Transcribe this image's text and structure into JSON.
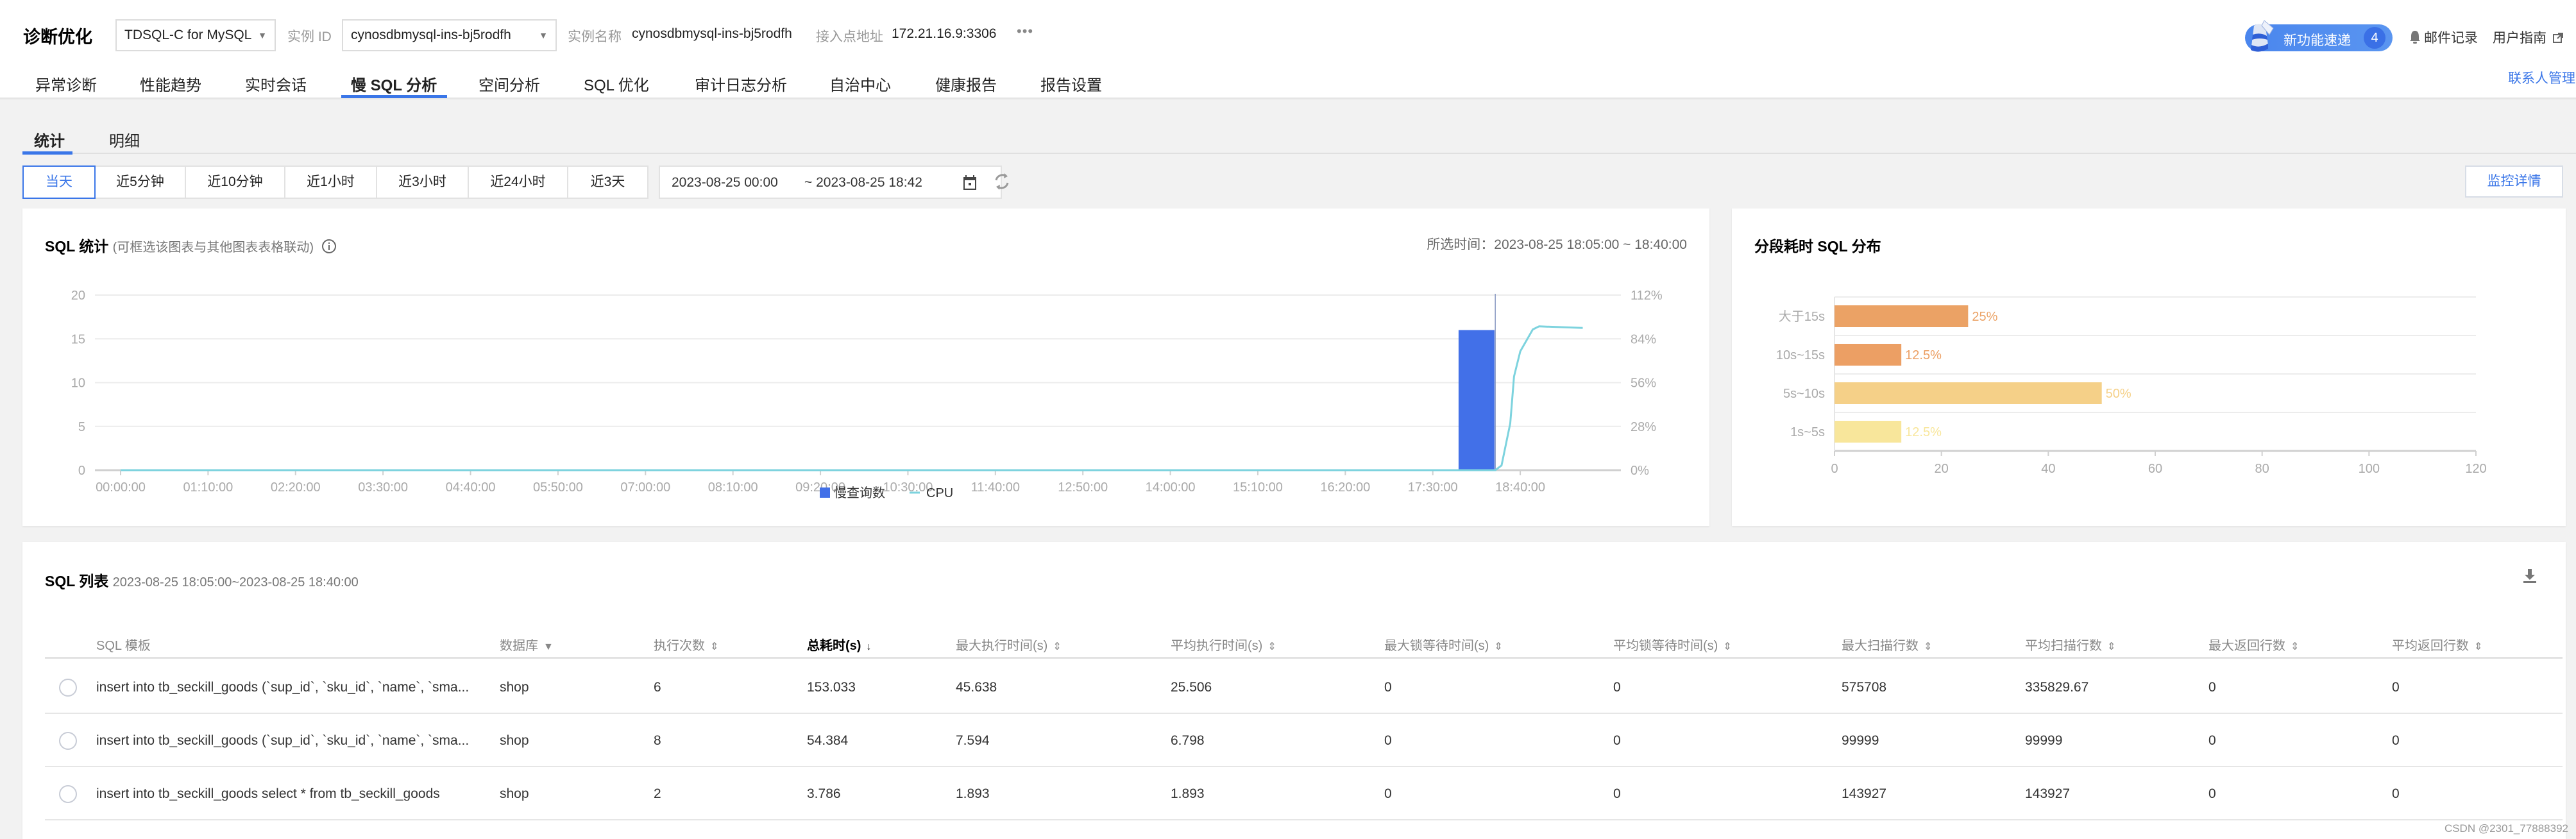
{
  "header": {
    "app_title": "诊断优化",
    "db_type": "TDSQL-C for MySQL",
    "instance_id_label": "实例 ID",
    "instance_id": "cynosdbmysql-ins-bj5rodfh",
    "instance_name_label": "实例名称",
    "instance_name": "cynosdbmysql-ins-bj5rodfh",
    "endpoint_label": "接入点地址",
    "endpoint": "172.21.16.9:3306",
    "more": "•••",
    "news_label": "新功能速递",
    "news_count": "4",
    "mail_label": "邮件记录",
    "guide_label": "用户指南",
    "contact_label": "联系人管理"
  },
  "nav_tabs": [
    {
      "label": "异常诊断"
    },
    {
      "label": "性能趋势"
    },
    {
      "label": "实时会话"
    },
    {
      "label": "慢 SQL 分析",
      "active": true
    },
    {
      "label": "空间分析"
    },
    {
      "label": "SQL 优化"
    },
    {
      "label": "审计日志分析"
    },
    {
      "label": "自治中心"
    },
    {
      "label": "健康报告"
    },
    {
      "label": "报告设置"
    }
  ],
  "sub_tabs": [
    {
      "label": "统计",
      "active": true
    },
    {
      "label": "明细"
    }
  ],
  "time_range": {
    "buttons": [
      "当天",
      "近5分钟",
      "近10分钟",
      "近1小时",
      "近3小时",
      "近24小时",
      "近3天"
    ],
    "active_index": 0,
    "start": "2023-08-25 00:00",
    "end": "~ 2023-08-25 18:42",
    "monitor_button": "监控详情"
  },
  "sql_stats_card": {
    "title": "SQL 统计",
    "subtitle": "(可框选该图表与其他图表表格联动)",
    "selected_time": "所选时间：2023-08-25 18:05:00 ~ 18:40:00"
  },
  "distribution_card": {
    "title": "分段耗时 SQL 分布"
  },
  "colors": {
    "accent": "#3a76e8",
    "bar_blue": "#4270e8",
    "cpu_line": "#7dd3de",
    "orange_dark": "#eba265",
    "orange_mid": "#ec9f64",
    "orange_light": "#f5d088",
    "yellow_light": "#f8e69b"
  },
  "chart_data": [
    {
      "type": "bar",
      "title": "SQL 统计",
      "x_ticks": [
        "00:00:00",
        "01:10:00",
        "02:20:00",
        "03:30:00",
        "04:40:00",
        "05:50:00",
        "07:00:00",
        "08:10:00",
        "09:20:00",
        "10:30:00",
        "11:40:00",
        "12:50:00",
        "14:00:00",
        "15:10:00",
        "17:30:00",
        "18:40:00"
      ],
      "x_ticks_all": [
        "00:00:00",
        "01:10:00",
        "02:20:00",
        "03:30:00",
        "04:40:00",
        "05:50:00",
        "07:00:00",
        "08:10:00",
        "09:20:00",
        "10:30:00",
        "11:40:00",
        "12:50:00",
        "14:00:00",
        "15:10:00",
        "16:20:00",
        "17:30:00",
        "18:40:00"
      ],
      "x_range_minutes": [
        0,
        1180
      ],
      "y_left": {
        "ticks": [
          0,
          5,
          10,
          15,
          20
        ],
        "range": [
          0,
          20
        ]
      },
      "y_right": {
        "ticks": [
          "0%",
          "28%",
          "56%",
          "84%",
          "112%"
        ],
        "range": [
          0,
          112
        ]
      },
      "series": [
        {
          "name": "慢查询数",
          "kind": "bar",
          "axis": "left",
          "points": [
            {
              "x_min": 1085,
              "y": 16
            }
          ]
        },
        {
          "name": "CPU",
          "kind": "line",
          "axis": "right",
          "points": [
            {
              "x_min": 0,
              "y": 0
            },
            {
              "x_min": 1100,
              "y": 0
            },
            {
              "x_min": 1105,
              "y": 3
            },
            {
              "x_min": 1112,
              "y": 30
            },
            {
              "x_min": 1115,
              "y": 60
            },
            {
              "x_min": 1120,
              "y": 76
            },
            {
              "x_min": 1130,
              "y": 90
            },
            {
              "x_min": 1135,
              "y": 92
            },
            {
              "x_min": 1170,
              "y": 91
            }
          ]
        }
      ],
      "crosshair_x_min": 1100,
      "legend": [
        "慢查询数",
        "CPU"
      ],
      "legend_position": "bottom"
    },
    {
      "type": "bar",
      "orientation": "horizontal",
      "title": "分段耗时 SQL 分布",
      "categories": [
        "大于15s",
        "10s~15s",
        "5s~10s",
        "1s~5s"
      ],
      "values": [
        25,
        12.5,
        50,
        12.5
      ],
      "labels": [
        "25%",
        "12.5%",
        "50%",
        "12.5%"
      ],
      "bar_colors": [
        "#eba265",
        "#ec9f64",
        "#f5d088",
        "#f8e69b"
      ],
      "x_ticks": [
        0,
        20,
        40,
        60,
        80,
        100,
        120
      ],
      "xlim": [
        0,
        120
      ]
    }
  ],
  "sql_list": {
    "title": "SQL 列表",
    "range": "2023-08-25 18:05:00~2023-08-25 18:40:00",
    "columns": [
      {
        "label": "SQL 模板",
        "sort": ""
      },
      {
        "label": "数据库",
        "sort": "filter"
      },
      {
        "label": "执行次数",
        "sort": "both"
      },
      {
        "label": "总耗时(s)",
        "sort": "desc",
        "sorted": true
      },
      {
        "label": "最大执行时间(s)",
        "sort": "both"
      },
      {
        "label": "平均执行时间(s)",
        "sort": "both"
      },
      {
        "label": "最大锁等待时间(s)",
        "sort": "both"
      },
      {
        "label": "平均锁等待时间(s)",
        "sort": "both"
      },
      {
        "label": "最大扫描行数",
        "sort": "both"
      },
      {
        "label": "平均扫描行数",
        "sort": "both"
      },
      {
        "label": "最大返回行数",
        "sort": "both"
      },
      {
        "label": "平均返回行数",
        "sort": "both"
      }
    ],
    "rows": [
      [
        "insert into tb_seckill_goods (`sup_id`, `sku_id`, `name`, `sma...",
        "shop",
        "6",
        "153.033",
        "45.638",
        "25.506",
        "0",
        "0",
        "575708",
        "335829.67",
        "0",
        "0"
      ],
      [
        "insert into tb_seckill_goods (`sup_id`, `sku_id`, `name`, `sma...",
        "shop",
        "8",
        "54.384",
        "7.594",
        "6.798",
        "0",
        "0",
        "99999",
        "99999",
        "0",
        "0"
      ],
      [
        "insert into tb_seckill_goods select * from tb_seckill_goods",
        "shop",
        "2",
        "3.786",
        "1.893",
        "1.893",
        "0",
        "0",
        "143927",
        "143927",
        "0",
        "0"
      ]
    ]
  },
  "watermark": "CSDN @2301_77888392"
}
